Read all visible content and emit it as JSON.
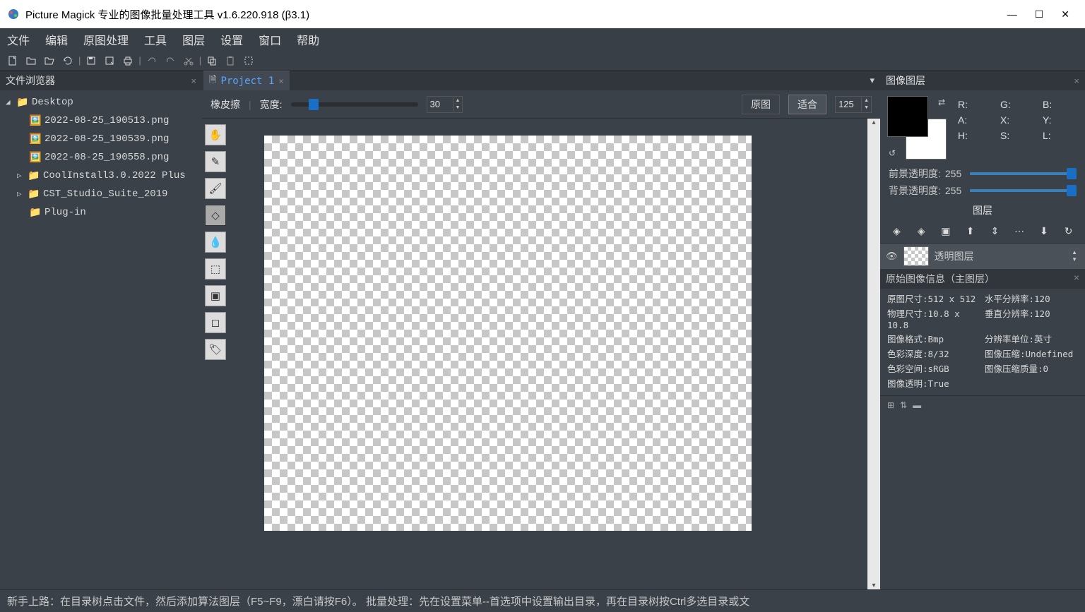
{
  "title": "Picture Magick 专业的图像批量处理工具 v1.6.220.918 (β3.1)",
  "menu": [
    "文件",
    "编辑",
    "原图处理",
    "工具",
    "图层",
    "设置",
    "窗口",
    "帮助"
  ],
  "left_panel": {
    "title": "文件浏览器",
    "tree": {
      "root": "Desktop",
      "png1": "2022-08-25_190513.png",
      "png2": "2022-08-25_190539.png",
      "png3": "2022-08-25_190558.png",
      "folder1": "CoolInstall3.0.2022 Plus",
      "folder2": "CST_Studio_Suite_2019",
      "folder3": "Plug-in"
    }
  },
  "tabs": {
    "project1": "Project 1"
  },
  "tool_options": {
    "current_tool": "橡皮擦",
    "width_label": "宽度:",
    "width_value": "30",
    "btn_original": "原图",
    "btn_fit": "适合",
    "zoom_value": "125"
  },
  "right_panel": {
    "title": "图像图层",
    "color_labels": {
      "R": "R:",
      "G": "G:",
      "B": "B:",
      "A": "A:",
      "X": "X:",
      "Y": "Y:",
      "H": "H:",
      "S": "S:",
      "L": "L:"
    },
    "fg_opacity_label": "前景透明度:",
    "fg_opacity_value": "255",
    "bg_opacity_label": "背景透明度:",
    "bg_opacity_value": "255",
    "layers_title": "图层",
    "layer_name": "透明图层",
    "info_title": "原始图像信息（主图层）",
    "info": {
      "k1": "原图尺寸:",
      "v1": "512 x 512",
      "k2": "水平分辨率:",
      "v2": "120",
      "k3": "物理尺寸:",
      "v3": "10.8 x 10.8",
      "k4": "垂直分辨率:",
      "v4": "120",
      "k5": "图像格式:",
      "v5": "Bmp",
      "k6": "分辨率单位:",
      "v6": "英寸",
      "k7": "色彩深度:",
      "v7": "8/32",
      "k8": "图像压缩:",
      "v8": "Undefined",
      "k9": "色彩空间:",
      "v9": "sRGB",
      "k10": "图像压缩质量:",
      "v10": "0",
      "k11": "图像透明:",
      "v11": "True"
    }
  },
  "statusbar": "新手上路：在目录树点击文件，然后添加算法图层（F5~F9，漂白请按F6）。   批量处理：先在设置菜单--首选项中设置输出目录，再在目录树按Ctrl多选目录或文"
}
